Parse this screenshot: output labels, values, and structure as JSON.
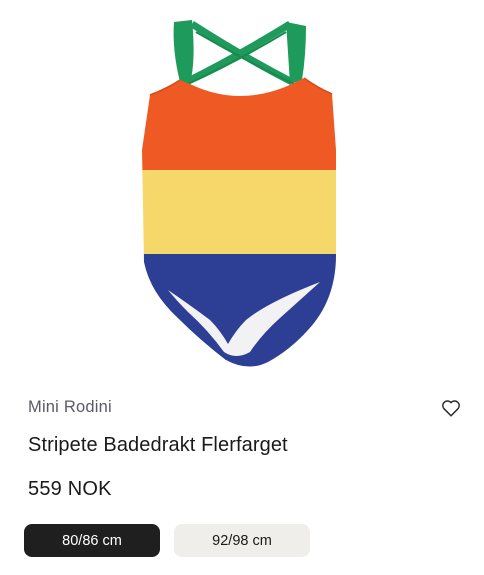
{
  "product": {
    "brand": "Mini Rodini",
    "title": "Stripete Badedrakt Flerfarget",
    "price": "559 NOK",
    "image_alt": "Stripete Badedrakt Flerfarget",
    "stripe_colors": {
      "straps": "#1e9a5a",
      "orange": "#ef5a24",
      "yellow": "#f6d86a",
      "blue": "#2c3f94",
      "lining": "#f2f2f4"
    }
  },
  "sizes": [
    {
      "label": "80/86 cm",
      "selected": true
    },
    {
      "label": "92/98 cm",
      "selected": false
    }
  ],
  "icons": {
    "wishlist": "heart-icon"
  }
}
